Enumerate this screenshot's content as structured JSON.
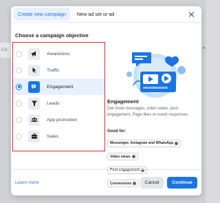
{
  "background": {
    "left_text": "Edi",
    "right_text": "ar e"
  },
  "tabs": [
    {
      "label": "Create new campaign",
      "active": true
    },
    {
      "label": "New ad set or ad",
      "active": false
    }
  ],
  "heading": "Choose a campaign objective",
  "objectives": [
    {
      "label": "Awareness",
      "icon": "megaphone-icon",
      "selected": false
    },
    {
      "label": "Traffic",
      "icon": "cursor-icon",
      "selected": false
    },
    {
      "label": "Engagement",
      "icon": "chat-bubble-icon",
      "selected": true
    },
    {
      "label": "Leads",
      "icon": "filter-icon",
      "selected": false
    },
    {
      "label": "App promotion",
      "icon": "people-icon",
      "selected": false
    },
    {
      "label": "Sales",
      "icon": "briefcase-icon",
      "selected": false
    }
  ],
  "detail": {
    "title": "Engagement",
    "description": "Get more messages, video views, post engagement, Page likes or event responses.",
    "good_for_label": "Good for:",
    "good_for": [
      "Messenger, Instagram and WhatsApp",
      "Video views",
      "Post engagement",
      "Conversions"
    ]
  },
  "footer": {
    "learn_more": "Learn more",
    "cancel": "Cancel",
    "continue": "Continue"
  },
  "colors": {
    "accent": "#1b74e4",
    "highlight_border": "#e0262e"
  }
}
